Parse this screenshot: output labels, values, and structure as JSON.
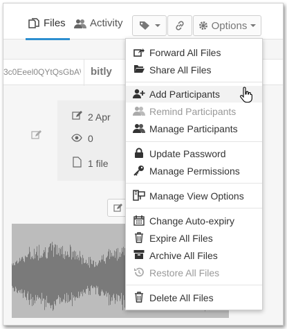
{
  "tabs": {
    "files": "Files",
    "activity": "Activity"
  },
  "toolbar": {
    "options_label": "Options"
  },
  "share": {
    "short_url_fragment": "3c0Eeel0QYtQsGbA\\",
    "shortener": "bitly"
  },
  "info": {
    "date": "2 Apr",
    "views": "0",
    "files": "1 file"
  },
  "menu": {
    "items": [
      {
        "label": "Forward All Files",
        "icon": "share-out-icon",
        "disabled": false
      },
      {
        "label": "Share All Files",
        "icon": "folder-open-icon",
        "disabled": false
      },
      {
        "label": "Add Participants",
        "icon": "user-plus-icon",
        "disabled": false
      },
      {
        "label": "Remind Participants",
        "icon": "users-icon",
        "disabled": true
      },
      {
        "label": "Manage Participants",
        "icon": "users-icon",
        "disabled": false
      },
      {
        "label": "Update Password",
        "icon": "lock-icon",
        "disabled": false
      },
      {
        "label": "Manage Permissions",
        "icon": "key-icon",
        "disabled": false
      },
      {
        "label": "Manage View Options",
        "icon": "view-options-icon",
        "disabled": false
      },
      {
        "label": "Change Auto-expiry",
        "icon": "calendar-icon",
        "disabled": false
      },
      {
        "label": "Expire All Files",
        "icon": "trash-icon",
        "disabled": false
      },
      {
        "label": "Archive All Files",
        "icon": "archive-icon",
        "disabled": false
      },
      {
        "label": "Restore All Files",
        "icon": "history-icon",
        "disabled": true
      },
      {
        "label": "Delete All Files",
        "icon": "trash-icon",
        "disabled": false
      }
    ]
  },
  "colors": {
    "accent": "#2d8fd0",
    "disabled_text": "#999999",
    "waveform": "#7a7a7a"
  }
}
